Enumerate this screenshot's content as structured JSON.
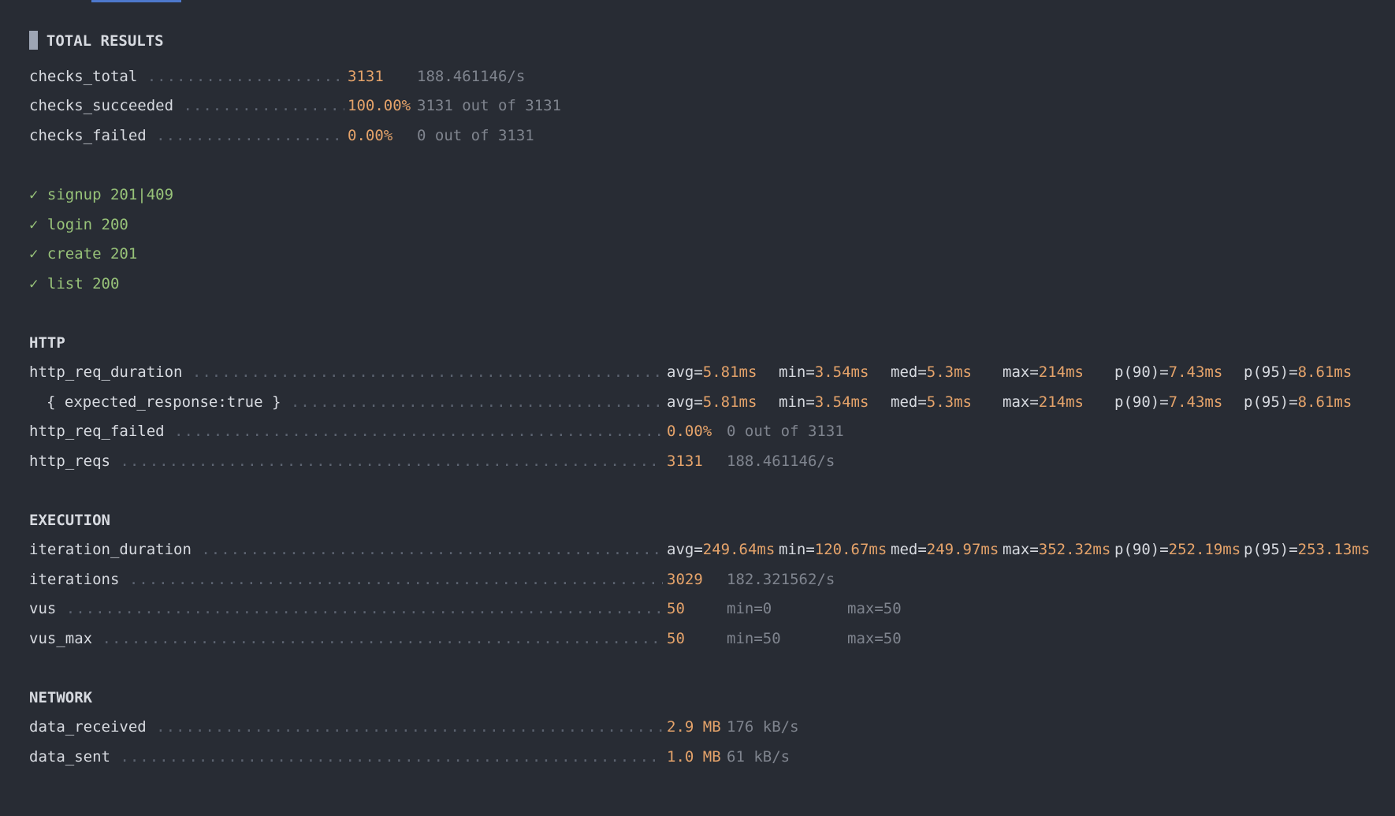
{
  "header": {
    "title": "TOTAL RESULTS"
  },
  "checks_summary": [
    {
      "name": "checks_total",
      "value": "3131",
      "extra": "188.461146/s"
    },
    {
      "name": "checks_succeeded",
      "value": "100.00%",
      "extra": "3131 out of 3131"
    },
    {
      "name": "checks_failed",
      "value": "0.00%",
      "extra": "0 out of 3131"
    }
  ],
  "checks": [
    {
      "mark": "✓",
      "label": "signup 201|409"
    },
    {
      "mark": "✓",
      "label": "login 200"
    },
    {
      "mark": "✓",
      "label": "create 201"
    },
    {
      "mark": "✓",
      "label": "list 200"
    }
  ],
  "http": {
    "title": "HTTP",
    "req_duration": {
      "name": "http_req_duration",
      "avg": "5.81ms",
      "min": "3.54ms",
      "med": "5.3ms",
      "max": "214ms",
      "p90": "7.43ms",
      "p95": "8.61ms"
    },
    "expected_response": {
      "name": "{ expected_response:true }",
      "avg": "5.81ms",
      "min": "3.54ms",
      "med": "5.3ms",
      "max": "214ms",
      "p90": "7.43ms",
      "p95": "8.61ms"
    },
    "req_failed": {
      "name": "http_req_failed",
      "value": "0.00%",
      "extra": "0 out of 3131"
    },
    "reqs": {
      "name": "http_reqs",
      "value": "3131",
      "extra": "188.461146/s"
    }
  },
  "execution": {
    "title": "EXECUTION",
    "iteration_duration": {
      "name": "iteration_duration",
      "avg": "249.64ms",
      "min": "120.67ms",
      "med": "249.97ms",
      "max": "352.32ms",
      "p90": "252.19ms",
      "p95": "253.13ms"
    },
    "iterations": {
      "name": "iterations",
      "value": "3029",
      "extra": "182.321562/s"
    },
    "vus": {
      "name": "vus",
      "value": "50",
      "min": "min=0",
      "max": "max=50"
    },
    "vus_max": {
      "name": "vus_max",
      "value": "50",
      "min": "min=50",
      "max": "max=50"
    }
  },
  "network": {
    "title": "NETWORK",
    "data_received": {
      "name": "data_received",
      "value": "2.9 MB",
      "extra": "176 kB/s"
    },
    "data_sent": {
      "name": "data_sent",
      "value": "1.0 MB",
      "extra": "61 kB/s"
    }
  },
  "stat_keys": {
    "avg": "avg=",
    "min": "min=",
    "med": "med=",
    "max": "max=",
    "p90": "p(90)=",
    "p95": "p(95)="
  },
  "colors": {
    "background": "#282c34",
    "text": "#d7dae0",
    "value": "#e5a36a",
    "dim": "#7f848e",
    "check": "#98c379",
    "tab_indicator": "#4d78cc"
  }
}
